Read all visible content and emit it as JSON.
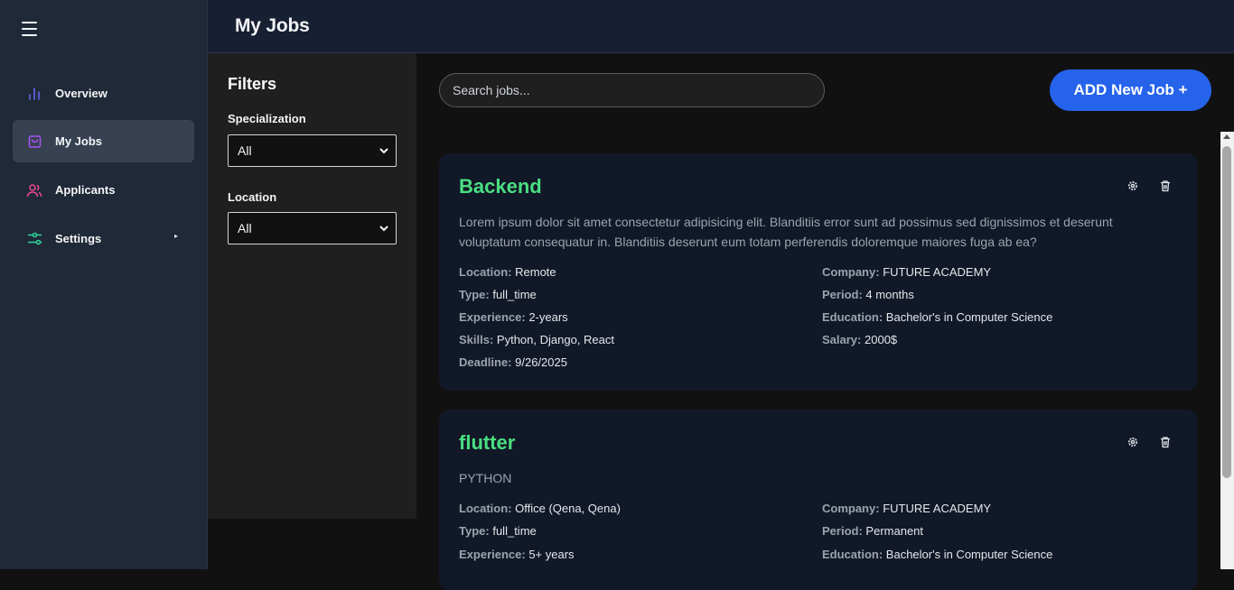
{
  "header": {
    "title": "My Jobs"
  },
  "sidebar": {
    "items": [
      {
        "label": "Overview",
        "icon": "bar-chart-icon"
      },
      {
        "label": "My Jobs",
        "icon": "shopping-bag-icon"
      },
      {
        "label": "Applicants",
        "icon": "users-icon"
      },
      {
        "label": "Settings",
        "icon": "sliders-icon"
      }
    ],
    "settings_caret": "▸"
  },
  "filters": {
    "title": "Filters",
    "specialization_label": "Specialization",
    "specialization_value": "All",
    "location_label": "Location",
    "location_value": "All"
  },
  "search": {
    "placeholder": "Search jobs..."
  },
  "add_button": "ADD New Job +",
  "jobs": [
    {
      "title": "Backend",
      "description": "Lorem ipsum dolor sit amet consectetur adipisicing elit. Blanditiis error sunt ad possimus sed dignissimos et deserunt voluptatum consequatur in. Blanditiis deserunt eum totam perferendis doloremque maiores fuga ab ea?",
      "fields": {
        "location": {
          "label": "Location:",
          "value": "Remote"
        },
        "type": {
          "label": "Type:",
          "value": "full_time"
        },
        "experience": {
          "label": "Experience:",
          "value": "2-years"
        },
        "skills": {
          "label": "Skills:",
          "value": "Python, Django, React"
        },
        "deadline": {
          "label": "Deadline:",
          "value": "9/26/2025"
        },
        "company": {
          "label": "Company:",
          "value": "FUTURE ACADEMY"
        },
        "period": {
          "label": "Period:",
          "value": "4 months"
        },
        "education": {
          "label": "Education:",
          "value": "Bachelor's in Computer Science"
        },
        "salary": {
          "label": "Salary:",
          "value": "2000$"
        }
      }
    },
    {
      "title": "flutter",
      "description": "PYTHON",
      "fields": {
        "location": {
          "label": "Location:",
          "value": "Office (Qena, Qena)"
        },
        "type": {
          "label": "Type:",
          "value": "full_time"
        },
        "experience": {
          "label": "Experience:",
          "value": "5+ years"
        },
        "company": {
          "label": "Company:",
          "value": "FUTURE ACADEMY"
        },
        "period": {
          "label": "Period:",
          "value": "Permanent"
        },
        "education": {
          "label": "Education:",
          "value": "Bachelor's in Computer Science"
        }
      }
    }
  ],
  "colors": {
    "accent": "#2563eb",
    "job_title": "#4ade80",
    "sidebar_bg": "#1f2937",
    "card_bg": "#111827"
  }
}
